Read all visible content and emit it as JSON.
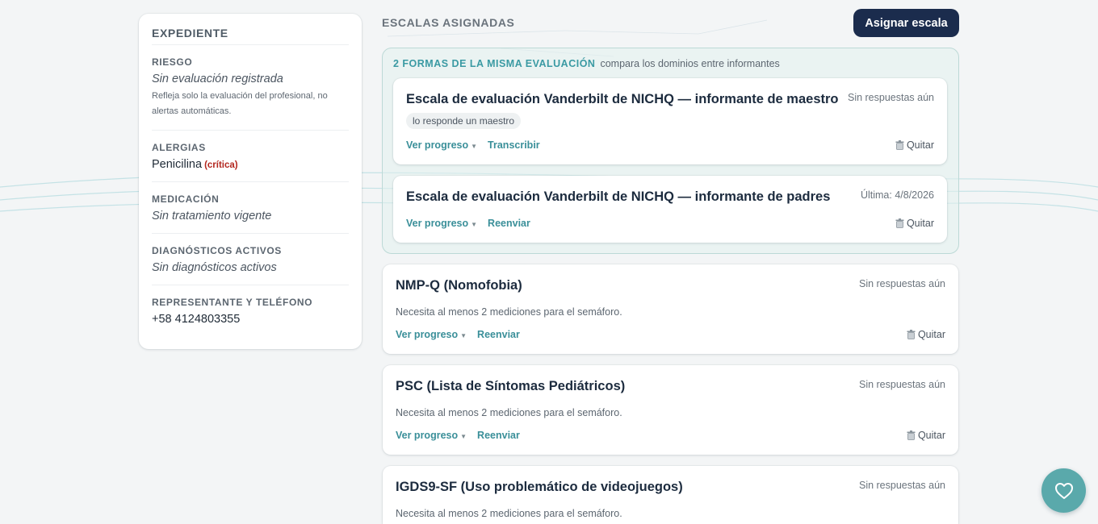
{
  "record": {
    "title": "EXPEDIENTE",
    "risk": {
      "label": "RIESGO",
      "value": "Sin evaluación registrada",
      "note": "Refleja solo la evaluación del profesional, no alertas automáticas."
    },
    "allergies": {
      "label": "ALERGIAS",
      "value": "Penicilina",
      "flag": "(crítica)"
    },
    "medication": {
      "label": "MEDICACIÓN",
      "value": "Sin tratamiento vigente"
    },
    "diagnoses": {
      "label": "DIAGNÓSTICOS ACTIVOS",
      "value": "Sin diagnósticos activos"
    },
    "guardian": {
      "label": "REPRESENTANTE Y TELÉFONO",
      "value": "+58 4124803355"
    }
  },
  "scales": {
    "title": "ESCALAS ASIGNADAS",
    "assign_label": "Asignar escala",
    "group": {
      "badge": "2 FORMAS DE LA MISMA EVALUACIÓN",
      "subtitle": "compara los dominios entre informantes",
      "cards": [
        {
          "title": "Escala de evaluación Vanderbilt de NICHQ — informante de maestro",
          "status": "Sin respuestas aún",
          "tag": "lo responde un maestro",
          "progress": "Ver progreso",
          "action": "Transcribir",
          "remove": "Quitar"
        },
        {
          "title": "Escala de evaluación Vanderbilt de NICHQ — informante de padres",
          "status": "Última: 4/8/2026",
          "progress": "Ver progreso",
          "action": "Reenviar",
          "remove": "Quitar"
        }
      ]
    },
    "cards": [
      {
        "title": "NMP-Q (Nomofobia)",
        "status": "Sin respuestas aún",
        "desc": "Necesita al menos 2 mediciones para el semáforo.",
        "progress": "Ver progreso",
        "action": "Reenviar",
        "remove": "Quitar"
      },
      {
        "title": "PSC (Lista de Síntomas Pediátricos)",
        "status": "Sin respuestas aún",
        "desc": "Necesita al menos 2 mediciones para el semáforo.",
        "progress": "Ver progreso",
        "action": "Reenviar",
        "remove": "Quitar"
      },
      {
        "title": "IGDS9-SF (Uso problemático de videojuegos)",
        "status": "Sin respuestas aún",
        "desc": "Necesita al menos 2 mediciones para el semáforo."
      }
    ]
  },
  "icons": {
    "caret": "caret-down-icon",
    "trash": "trash-icon",
    "fab": "heart-icon"
  },
  "colors": {
    "accent": "#3a8f99",
    "primary_button": "#1b2c4d",
    "critical": "#b3261e",
    "fab": "#5aa9ab"
  }
}
